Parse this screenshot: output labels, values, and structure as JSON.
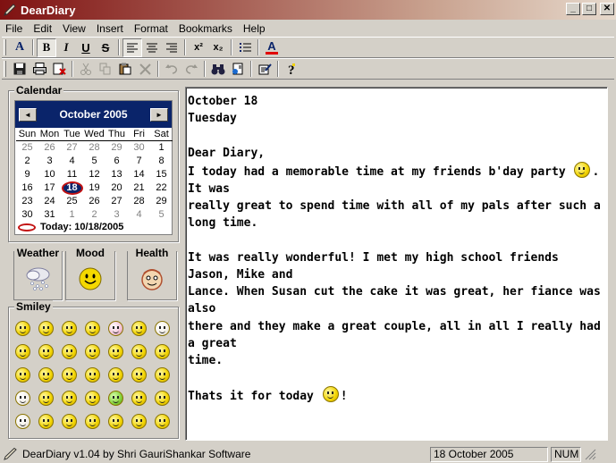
{
  "window": {
    "title": "DearDiary",
    "minimize": "_",
    "maximize": "□",
    "close": "✕"
  },
  "menu": [
    "File",
    "Edit",
    "View",
    "Insert",
    "Format",
    "Bookmarks",
    "Help"
  ],
  "toolbar_format": {
    "font_color_top": "A",
    "bold": "B",
    "italic": "I",
    "underline": "U",
    "strike": "S",
    "superscript": "x²",
    "subscript": "x₂",
    "font_color": "A"
  },
  "calendar": {
    "group_label": "Calendar",
    "month_label": "October 2005",
    "prev": "◄",
    "next": "►",
    "dow": [
      "Sun",
      "Mon",
      "Tue",
      "Wed",
      "Thu",
      "Fri",
      "Sat"
    ],
    "weeks": [
      [
        "25",
        "26",
        "27",
        "28",
        "29",
        "30",
        "1"
      ],
      [
        "2",
        "3",
        "4",
        "5",
        "6",
        "7",
        "8"
      ],
      [
        "9",
        "10",
        "11",
        "12",
        "13",
        "14",
        "15"
      ],
      [
        "16",
        "17",
        "18",
        "19",
        "20",
        "21",
        "22"
      ],
      [
        "23",
        "24",
        "25",
        "26",
        "27",
        "28",
        "29"
      ],
      [
        "30",
        "31",
        "1",
        "2",
        "3",
        "4",
        "5"
      ]
    ],
    "selected_day": "18",
    "today_label": "Today: 10/18/2005"
  },
  "status_boxes": {
    "weather_label": "Weather",
    "mood_label": "Mood",
    "health_label": "Health"
  },
  "smiley_group_label": "Smiley",
  "smiley_count": 35,
  "editor": {
    "lines": [
      "October 18",
      "Tuesday",
      "",
      "Dear Diary,",
      "I today had a memorable time at my friends b'day party ",
      ". It was",
      "really great to spend time with all of my pals after such a long time.",
      "",
      "It was really wonderful! I met my high school friends Jason, Mike and",
      "Lance. When Susan cut the cake it was great, her fiance was also",
      "there and they make a great couple, all in all I really had a great",
      "time.",
      "",
      "Thats it for today ",
      "!"
    ]
  },
  "statusbar": {
    "app_info": "DearDiary v1.04 by Shri GauriShankar Software",
    "date": "18 October 2005",
    "num": "NUM"
  },
  "colors": {
    "title_start": "#7f1111",
    "calendar_header": "#0a246a",
    "selected_ring": "#c21212"
  }
}
